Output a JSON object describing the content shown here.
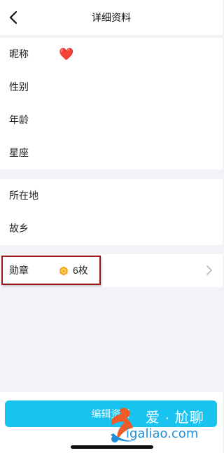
{
  "header": {
    "title": "详细资料"
  },
  "group1": {
    "rows": [
      {
        "label": "昵称",
        "value": "❤️"
      },
      {
        "label": "性别"
      },
      {
        "label": "年龄"
      },
      {
        "label": "星座"
      }
    ]
  },
  "group2": {
    "rows": [
      {
        "label": "所在地"
      },
      {
        "label": "故乡"
      }
    ]
  },
  "badges": {
    "label": "勋章",
    "count": "6枚"
  },
  "footer": {
    "edit_label": "编辑资料"
  },
  "watermark": {
    "text": "爱 · 尬聊",
    "url": "igaliao.com"
  },
  "colors": {
    "accent": "#19c3f0",
    "highlight_border": "#9a1a1a",
    "background": "#f2f3f7"
  }
}
